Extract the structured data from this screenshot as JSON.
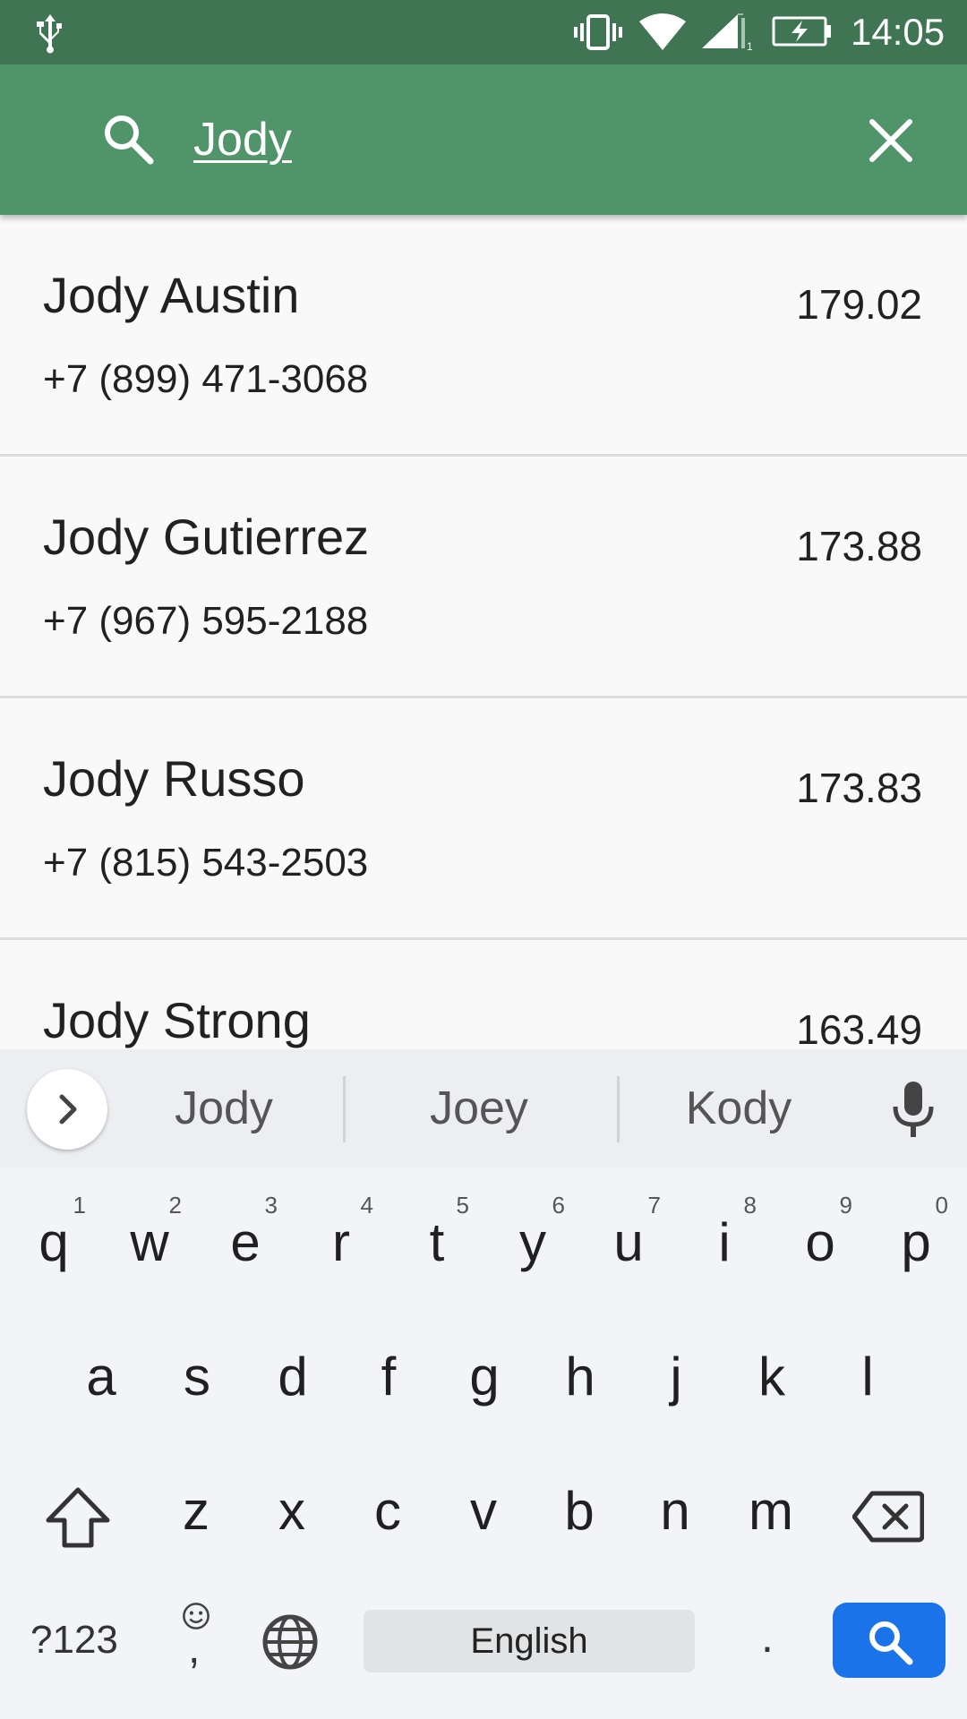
{
  "status_bar": {
    "time": "14:05",
    "icons": [
      "usb-icon",
      "vibrate-icon",
      "wifi-icon",
      "signal-icon",
      "battery-charging-icon"
    ]
  },
  "search": {
    "query": "Jody",
    "icons": [
      "search-icon",
      "close-icon"
    ]
  },
  "results": [
    {
      "name": "Jody Austin",
      "phone": "+7 (899) 471-3068",
      "value": "179.02"
    },
    {
      "name": "Jody Gutierrez",
      "phone": "+7 (967) 595-2188",
      "value": "173.88"
    },
    {
      "name": "Jody Russo",
      "phone": "+7 (815) 543-2503",
      "value": "173.83"
    },
    {
      "name": "Jody Strong",
      "phone": "",
      "value": "163.49"
    }
  ],
  "keyboard": {
    "suggestions": [
      "Jody",
      "Joey",
      "Kody"
    ],
    "row1": [
      {
        "k": "q",
        "h": "1"
      },
      {
        "k": "w",
        "h": "2"
      },
      {
        "k": "e",
        "h": "3"
      },
      {
        "k": "r",
        "h": "4"
      },
      {
        "k": "t",
        "h": "5"
      },
      {
        "k": "y",
        "h": "6"
      },
      {
        "k": "u",
        "h": "7"
      },
      {
        "k": "i",
        "h": "8"
      },
      {
        "k": "o",
        "h": "9"
      },
      {
        "k": "p",
        "h": "0"
      }
    ],
    "row2": [
      "a",
      "s",
      "d",
      "f",
      "g",
      "h",
      "j",
      "k",
      "l"
    ],
    "row3": [
      "z",
      "x",
      "c",
      "v",
      "b",
      "n",
      "m"
    ],
    "symbols_label": "?123",
    "emoji_comma": ",",
    "space_label": "English",
    "period": ".",
    "accent_color": "#1a73e8"
  }
}
